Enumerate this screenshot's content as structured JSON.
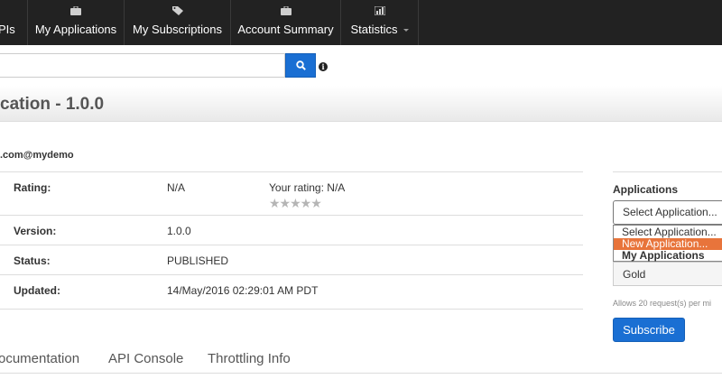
{
  "nav": {
    "items": [
      {
        "label": "PIs",
        "icon": null
      },
      {
        "label": "My Applications",
        "icon": "briefcase-icon"
      },
      {
        "label": "My Subscriptions",
        "icon": "tags-icon"
      },
      {
        "label": "Account Summary",
        "icon": "briefcase-icon"
      },
      {
        "label": "Statistics",
        "icon": "bar-chart-icon"
      }
    ]
  },
  "search": {
    "value": "",
    "placeholder": ""
  },
  "title": "cation - 1.0.0",
  "provider": ".com@mydemo",
  "details": {
    "rating_label": "Rating:",
    "rating_value": "N/A",
    "your_rating_label": "Your rating:",
    "your_rating_value": "N/A",
    "stars": "★★★★★",
    "version_label": "Version:",
    "version_value": "1.0.0",
    "status_label": "Status:",
    "status_value": "PUBLISHED",
    "updated_label": "Updated:",
    "updated_value": "14/May/2016 02:29:01 AM PDT"
  },
  "tabs": [
    "ocumentation",
    "API Console",
    "Throttling Info"
  ],
  "subscribe_panel": {
    "heading": "Applications",
    "selected": "Select Application...",
    "options": [
      "Select Application...",
      "New Application..."
    ],
    "group_label": "My Applications",
    "tier": "Gold",
    "tier_note": "Allows 20 request(s) per mi",
    "subscribe_label": "Subscribe"
  },
  "colors": {
    "navbar": "#222222",
    "primary": "#1a6fd3",
    "highlight": "#e8743b"
  }
}
